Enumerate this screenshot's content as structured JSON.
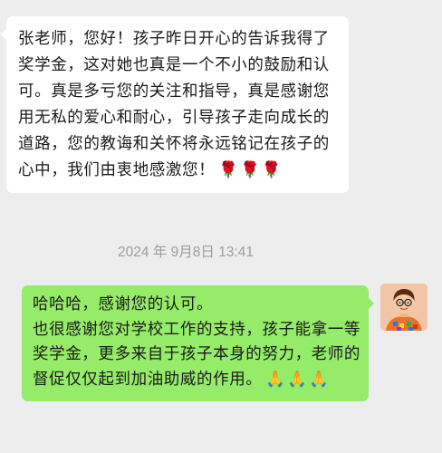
{
  "messages": {
    "teacher_incoming": {
      "text": "张老师，您好！孩子昨日开心的告诉我得了奖学金，这对她也真是一个不小的鼓励和认可。真是多亏您的关注和指导，真是感谢您用无私的爱心和耐心，引导孩子走向成长的道路，您的教诲和关怀将永远铭记在孩子的心中，我们由衷地感激您！",
      "emoji": "🌹🌹🌹"
    },
    "timestamp": "2024 年 9月8日 13:41",
    "reply": {
      "line1": "哈哈哈，感谢您的认可。",
      "line2": "也很感谢您对学校工作的支持，孩子能拿一等奖学金，更多来自于孩子本身的努力，老师的督促仅仅起到加油助威的作用。",
      "emoji": "🙏🙏🙏"
    }
  },
  "colors": {
    "background": "#ededed",
    "incoming_bubble": "#ffffff",
    "outgoing_bubble": "#95ec69",
    "timestamp_text": "#9c9c9c"
  },
  "icons": {
    "rose": "rose-emoji",
    "pray": "folded-hands-emoji",
    "avatar": "teacher-avatar"
  }
}
